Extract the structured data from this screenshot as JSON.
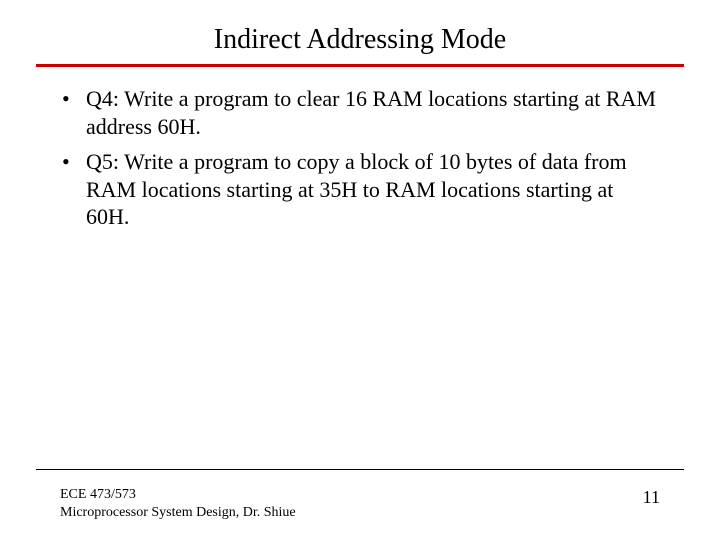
{
  "title": "Indirect Addressing Mode",
  "bullets": [
    "Q4: Write a program to clear 16 RAM locations starting at RAM address 60H.",
    "Q5: Write a program to copy a block of 10 bytes of data from RAM locations starting at 35H to RAM locations starting at 60H."
  ],
  "footer": {
    "course_code": "ECE 473/573",
    "course_title": "Microprocessor System Design, Dr. Shiue",
    "page_number": "11"
  }
}
